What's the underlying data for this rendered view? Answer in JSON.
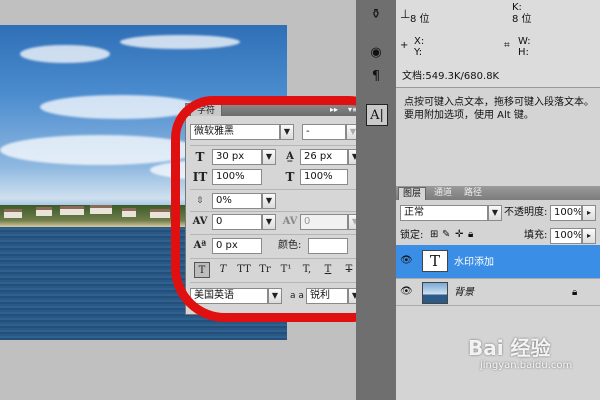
{
  "info": {
    "bit_left": "8 位",
    "k_label": "K:",
    "bit_right": "8 位",
    "x_label": "X:",
    "y_label": "Y:",
    "w_label": "W:",
    "h_label": "H:",
    "doc_size": "文档:549.3K/680.8K"
  },
  "hint": "点按可键入点文本，拖移可键入段落文本。要用附加选项，使用 Alt 键。",
  "char_panel": {
    "tab": "字符",
    "font_family": "微软雅黑",
    "font_style": "-",
    "font_size": "30 px",
    "leading": "26 px",
    "vertical_scale": "100%",
    "horizontal_scale": "100%",
    "tracking_ratio": "0%",
    "kerning": "0",
    "tracking": "0",
    "baseline_shift": "0 px",
    "color_label": "颜色:",
    "style_buttons": [
      "T",
      "T",
      "TT",
      "Tr",
      "T¹",
      "T,",
      "T",
      "T"
    ],
    "language": "美国英语",
    "aa_icon_label": "a a",
    "antialias": "锐利"
  },
  "layers": {
    "tabs": [
      "图层",
      "通道",
      "路径"
    ],
    "blend_mode": "正常",
    "opacity_label": "不透明度:",
    "opacity": "100%",
    "lock_label": "锁定:",
    "fill_label": "填充:",
    "fill": "100%",
    "rows": [
      {
        "name": "水印添加",
        "selected": true
      },
      {
        "name": "背景",
        "selected": false
      }
    ]
  },
  "watermark": {
    "brand": "Bai 经验",
    "url": "jingyan.baidu.com"
  },
  "colors": {
    "annotation": "#e01010",
    "selection": "#3a8ee6"
  }
}
